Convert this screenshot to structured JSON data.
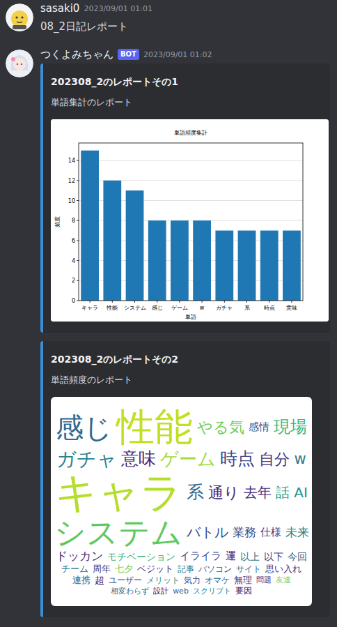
{
  "messages": [
    {
      "author": "sasaki0",
      "time": "2023/09/01 01:01",
      "text": "08_2日記レポート",
      "embeds": []
    },
    {
      "author": "つくよみちゃん",
      "badge": "BOT",
      "time": "2023/09/01 01:02",
      "text": "",
      "embeds": [
        {
          "kind": "bar_chart",
          "title": "202308_2のレポートその1",
          "description": "単語集計のレポート",
          "chart": {
            "title": "単語頻度集計",
            "x_label": "単語",
            "y_label": "頻度",
            "y_ticks": [
              "0",
              "2",
              "4",
              "6",
              "8",
              "10",
              "12",
              "14"
            ],
            "categories": [
              "キャラ",
              "性能",
              "システム",
              "感じ",
              "ゲーム",
              "w",
              "ガチャ",
              "系",
              "時点",
              "意味"
            ],
            "values": [
              15,
              12,
              11,
              8,
              8,
              8,
              7,
              7,
              7,
              7
            ]
          }
        },
        {
          "kind": "word_cloud",
          "title": "202308_2のレポートその2",
          "description": "単語頻度のレポート",
          "words": [
            {
              "text": "感じ",
              "level": 0.6,
              "color": "#31688e"
            },
            {
              "text": "性能",
              "level": 0.9,
              "color": "#c2df23"
            },
            {
              "text": "やる気",
              "level": 0.24,
              "color": "#6ece58"
            },
            {
              "text": "感情",
              "level": 0.1,
              "color": "#3b528b"
            },
            {
              "text": "現場",
              "level": 0.28,
              "color": "#35b779"
            },
            {
              "text": "ガチャ",
              "level": 0.36,
              "color": "#26828e"
            },
            {
              "text": "意味",
              "level": 0.3,
              "color": "#482878"
            },
            {
              "text": "ゲーム",
              "level": 0.32,
              "color": "#a0da39"
            },
            {
              "text": "時点",
              "level": 0.3,
              "color": "#3e4989"
            },
            {
              "text": "自分",
              "level": 0.24,
              "color": "#443983"
            },
            {
              "text": "w",
              "level": 0.22,
              "color": "#2a788e"
            },
            {
              "text": "キャラ",
              "level": 1.0,
              "color": "#b5de2b"
            },
            {
              "text": "系",
              "level": 0.3,
              "color": "#31688e"
            },
            {
              "text": "通り",
              "level": 0.24,
              "color": "#482475"
            },
            {
              "text": "去年",
              "level": 0.2,
              "color": "#472d7b"
            },
            {
              "text": "話",
              "level": 0.2,
              "color": "#1f9e89"
            },
            {
              "text": "AI",
              "level": 0.2,
              "color": "#21918c"
            },
            {
              "text": "システム",
              "level": 0.7,
              "color": "#5ec962"
            },
            {
              "text": "バトル",
              "level": 0.2,
              "color": "#3b528b"
            },
            {
              "text": "業務",
              "level": 0.14,
              "color": "#3b528b"
            },
            {
              "text": "仕様",
              "level": 0.1,
              "color": "#443983"
            },
            {
              "text": "未来",
              "level": 0.14,
              "color": "#26828e"
            },
            {
              "text": "ドッカン",
              "level": 0.14,
              "color": "#482878"
            },
            {
              "text": "モチベーション",
              "level": 0.08,
              "color": "#35b779"
            },
            {
              "text": "イライラ",
              "level": 0.1,
              "color": "#3e4989"
            },
            {
              "text": "運",
              "level": 0.1,
              "color": "#440154"
            },
            {
              "text": "以上",
              "level": 0.08,
              "color": "#2a788e"
            },
            {
              "text": "以下",
              "level": 0.08,
              "color": "#414487"
            },
            {
              "text": "今回",
              "level": 0.08,
              "color": "#355f8d"
            },
            {
              "text": "チーム",
              "level": 0.06,
              "color": "#2c728e"
            },
            {
              "text": "周年",
              "level": 0.06,
              "color": "#443983"
            },
            {
              "text": "七夕",
              "level": 0.06,
              "color": "#7ad151"
            },
            {
              "text": "ベジット",
              "level": 0.06,
              "color": "#472d7b"
            },
            {
              "text": "記事",
              "level": 0.04,
              "color": "#2a788e"
            },
            {
              "text": "パソコン",
              "level": 0.04,
              "color": "#3b528b"
            },
            {
              "text": "サイト",
              "level": 0.04,
              "color": "#31688e"
            },
            {
              "text": "思い入れ",
              "level": 0.06,
              "color": "#46327e"
            },
            {
              "text": "連携",
              "level": 0.06,
              "color": "#33638d"
            },
            {
              "text": "超",
              "level": 0.08,
              "color": "#481f70"
            },
            {
              "text": "ユーザー",
              "level": 0.04,
              "color": "#3e4989"
            },
            {
              "text": "メリット",
              "level": 0.04,
              "color": "#218f8d"
            },
            {
              "text": "気力",
              "level": 0.04,
              "color": "#3b528b"
            },
            {
              "text": "オマケ",
              "level": 0.04,
              "color": "#2d708e"
            },
            {
              "text": "無理",
              "level": 0.06,
              "color": "#472d7b"
            },
            {
              "text": "問題",
              "level": 0.02,
              "color": "#46337e"
            },
            {
              "text": "友達",
              "level": 0.02,
              "color": "#6ece58"
            },
            {
              "text": "相変わらず",
              "level": 0.02,
              "color": "#2c728e"
            },
            {
              "text": "設計",
              "level": 0.02,
              "color": "#440154"
            },
            {
              "text": "web",
              "level": 0.02,
              "color": "#31688e"
            },
            {
              "text": "スクリプト",
              "level": 0.02,
              "color": "#277f8e"
            },
            {
              "text": "要因",
              "level": 0.04,
              "color": "#481668"
            }
          ]
        }
      ]
    }
  ]
}
